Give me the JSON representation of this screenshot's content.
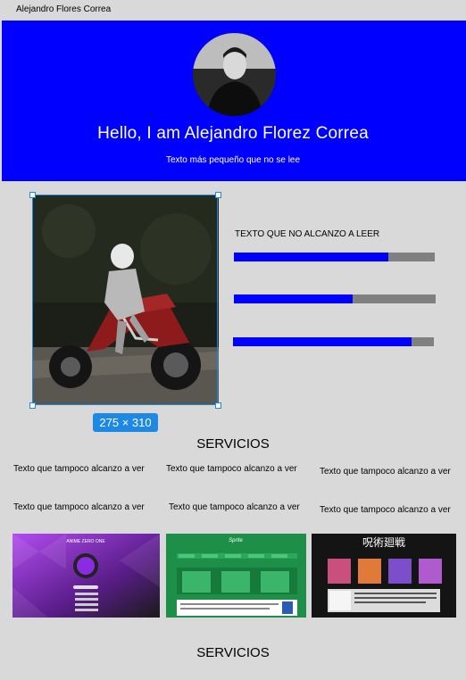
{
  "frame_label": "Alejandro Flores Correa",
  "hero": {
    "title": "Hello, I am Alejandro Florez Correa",
    "subtitle": "Texto más pequeño que no se lee",
    "background": "#0000ff"
  },
  "about": {
    "selection_size": "275 × 310",
    "skills_label": "TEXTO QUE NO ALCANZO A LEER",
    "skills": [
      {
        "progress": 0.77
      },
      {
        "progress": 0.59
      },
      {
        "progress": 0.89
      }
    ],
    "bar_fill_color": "#0000ff",
    "bar_track_color": "#808080"
  },
  "services": {
    "title": "SERVICIOS",
    "blurbs": [
      "Texto que tampoco alcanzo a ver",
      "Texto que tampoco alcanzo a ver",
      "Texto que tampoco alcanzo a ver",
      "Texto que tampoco alcanzo a ver",
      "Texto que tampoco alcanzo a ver",
      "Texto que tampoco alcanzo a ver"
    ],
    "thumb_text": {
      "anime": "ANIME ZERO ONE",
      "sprite": "Sprite",
      "manga": "呪術廻戦"
    }
  },
  "services_2": {
    "title": "SERVICIOS"
  },
  "colors": {
    "selection": "#1e88e5",
    "page_bg": "#d9d9d9"
  }
}
